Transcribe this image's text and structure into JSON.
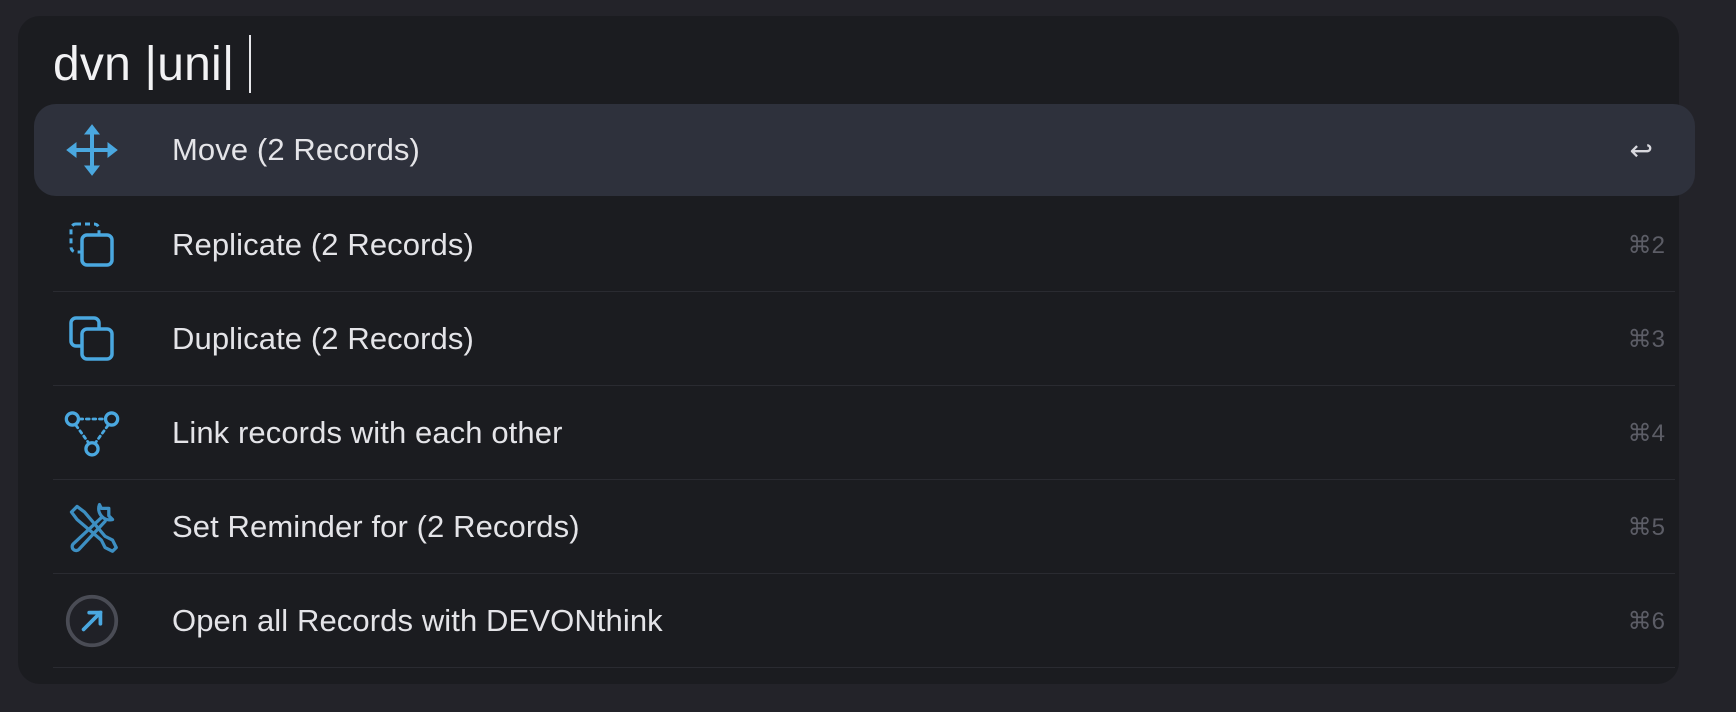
{
  "search": {
    "query": "dvn |uni|"
  },
  "results": [
    {
      "label": "Move (2 Records)",
      "shortcut": "↩",
      "icon": "move-arrows-icon",
      "selected": true
    },
    {
      "label": "Replicate (2 Records)",
      "shortcut": "⌘2",
      "icon": "replicate-icon",
      "selected": false
    },
    {
      "label": "Duplicate (2 Records)",
      "shortcut": "⌘3",
      "icon": "duplicate-icon",
      "selected": false
    },
    {
      "label": "Link records with each other",
      "shortcut": "⌘4",
      "icon": "link-nodes-icon",
      "selected": false
    },
    {
      "label": "Set Reminder for (2 Records)",
      "shortcut": "⌘5",
      "icon": "tools-icon",
      "selected": false
    },
    {
      "label": "Open all Records with DEVONthink",
      "shortcut": "⌘6",
      "icon": "open-arrow-icon",
      "selected": false
    }
  ],
  "colors": {
    "background": "#232329",
    "panel": "#1b1c20",
    "selected_row": "#2e313c",
    "icon_accent": "#4aa8e0",
    "text": "#e4e4e8",
    "shortcut": "#5c5d66"
  }
}
